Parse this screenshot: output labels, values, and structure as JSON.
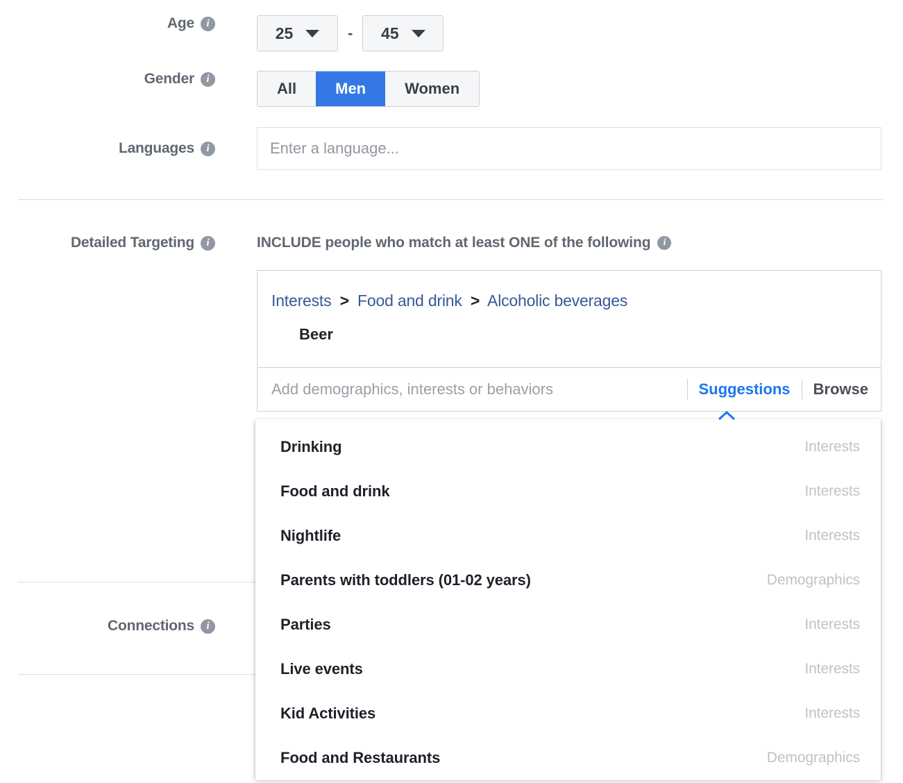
{
  "form": {
    "age": {
      "label": "Age",
      "info_icon": "info-icon",
      "min": "25",
      "separator": "-",
      "max": "45"
    },
    "gender": {
      "label": "Gender",
      "info_icon": "info-icon",
      "options": [
        {
          "label": "All",
          "selected": false
        },
        {
          "label": "Men",
          "selected": true
        },
        {
          "label": "Women",
          "selected": false
        }
      ]
    },
    "languages": {
      "label": "Languages",
      "info_icon": "info-icon",
      "value": "",
      "placeholder": "Enter a language..."
    },
    "detailed_targeting": {
      "label": "Detailed Targeting",
      "info_icon": "info-icon",
      "include_header": "INCLUDE people who match at least ONE of the following",
      "include_header_info_icon": "info-icon",
      "breadcrumb": {
        "items": [
          "Interests",
          "Food and drink",
          "Alcoholic beverages"
        ],
        "separator": ">"
      },
      "selected_item": "Beer",
      "search": {
        "value": "",
        "placeholder": "Add demographics, interests or behaviors"
      },
      "tabs": [
        {
          "label": "Suggestions",
          "active": true
        },
        {
          "label": "Browse",
          "active": false
        }
      ],
      "caret_icon": "chevron-up-icon",
      "suggestions": [
        {
          "label": "Drinking",
          "category": "Interests"
        },
        {
          "label": "Food and drink",
          "category": "Interests"
        },
        {
          "label": "Nightlife",
          "category": "Interests"
        },
        {
          "label": "Parents with toddlers (01-02 years)",
          "category": "Demographics"
        },
        {
          "label": "Parties",
          "category": "Interests"
        },
        {
          "label": "Live events",
          "category": "Interests"
        },
        {
          "label": "Kid Activities",
          "category": "Interests"
        },
        {
          "label": "Food and Restaurants",
          "category": "Demographics"
        }
      ]
    },
    "connections": {
      "label": "Connections",
      "info_icon": "info-icon"
    }
  },
  "colors": {
    "accent_blue": "#3578E5",
    "link_blue": "#1877F2",
    "breadcrumb_blue": "#385898",
    "label_gray": "#606770",
    "text_dark": "#1d2129",
    "category_gray": "#bec3c9",
    "border_gray": "#ccd0d5",
    "divider_gray": "#dcdee1",
    "segment_bg": "#f5f6f7"
  }
}
